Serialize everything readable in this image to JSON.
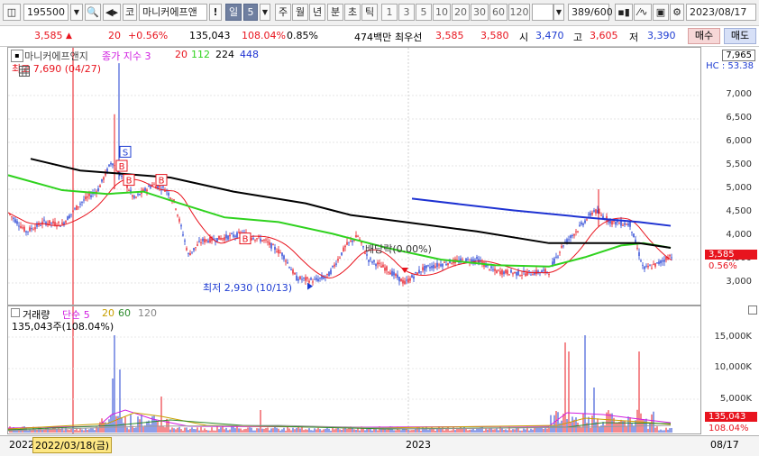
{
  "toolbar": {
    "code": "195500",
    "market": "코",
    "stock_name": "마니커에프앤",
    "warn": "!",
    "periods": [
      "일",
      "주",
      "월",
      "년",
      "분",
      "초",
      "틱"
    ],
    "selected_period": "일",
    "period_value": "5",
    "intervals": [
      "1",
      "3",
      "5",
      "10",
      "20",
      "30",
      "60",
      "120"
    ],
    "count": "389/600",
    "date": "2023/08/17"
  },
  "info": {
    "price": "3,585",
    "change": "20",
    "change_pct": "+0.56%",
    "volume": "135,043",
    "volume_ratio": "108.04%",
    "turnover": "0.85%",
    "amount": "474백만",
    "best_label": "최우선",
    "ask": "3,585",
    "bid": "3,580",
    "open_label": "시",
    "open": "3,470",
    "high_label": "고",
    "high": "3,605",
    "low_label": "저",
    "low": "3,390",
    "buy": "매수",
    "sell": "매도"
  },
  "price_panel": {
    "title": "마니커에프앤지",
    "legend_label": "종가 지수 3",
    "ma": [
      "20",
      "112",
      "224",
      "448"
    ],
    "high_note": "최고 7,690 (04/27)",
    "low_note": "최저 2,930 (10/13)",
    "dividend_note": "배당락(0.00%)",
    "hc_note": "HC : 53.38",
    "current_price_tag": "3,585",
    "current_pct_tag": "0.56%",
    "top_tag": "7,965",
    "y_ticks": [
      "7,000",
      "6,500",
      "6,000",
      "5,500",
      "5,000",
      "4,500",
      "4,000",
      "3,500",
      "3,000"
    ]
  },
  "volume_panel": {
    "title": "거래량",
    "legend_label": "단순 5",
    "ma": [
      "20",
      "60",
      "120"
    ],
    "value_note": "135,043주(108.04%)",
    "y_ticks": [
      "15,000K",
      "10,000K",
      "5,000K"
    ],
    "value_tag": "135,043",
    "pct_tag": "108.04%"
  },
  "x_axis": {
    "year_start": "2022",
    "cursor_date": "2022/03/18(금)",
    "year_mid": "2023",
    "end_date": "08/17"
  },
  "colors": {
    "up": "#e8141e",
    "down": "#1e3cd2",
    "ma20": "#e8141e",
    "ma112": "#2fd21e",
    "ma224": "#000000",
    "ma448": "#1e32d2"
  }
}
